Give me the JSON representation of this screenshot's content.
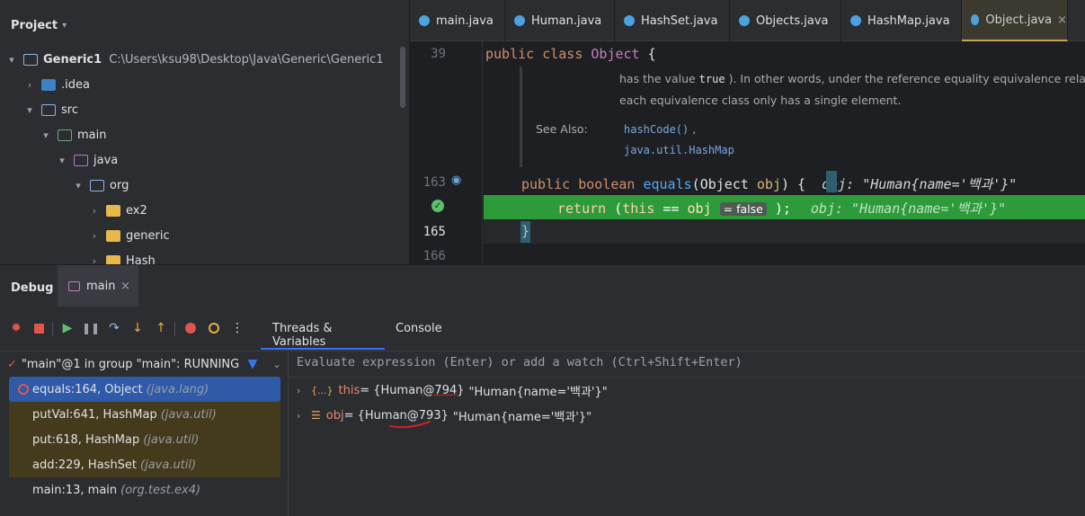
{
  "project": {
    "title": "Project",
    "root": {
      "name": "Generic1",
      "path": "C:\\Users\\ksu98\\Desktop\\Java\\Generic\\Generic1"
    },
    "items": [
      ".idea",
      "src",
      "main",
      "java",
      "org",
      "ex2",
      "generic",
      "Hash"
    ]
  },
  "editor": {
    "tabs": [
      {
        "label": "main.java"
      },
      {
        "label": "Human.java"
      },
      {
        "label": "HashSet.java"
      },
      {
        "label": "Objects.java"
      },
      {
        "label": "HashMap.java"
      },
      {
        "label": "Object.java",
        "close": "×"
      }
    ],
    "line_numbers": {
      "l39": "39",
      "l163": "163",
      "l165": "165",
      "l166": "166"
    },
    "code": {
      "line39": {
        "kw1": "public",
        "kw2": "class",
        "cls": "Object",
        "rest": " {"
      },
      "doc1_a": "has the value ",
      "doc1_code": "true",
      "doc1_b": "). In other words, under the reference equality equivalence relation,",
      "doc2": "each equivalence class only has a single element.",
      "see_also": "See Also:",
      "see_link1": "hashCode()",
      "see_link1_suffix": ",",
      "see_link2": "java.util.HashMap",
      "line163": {
        "kw1": "public",
        "kw2": "boolean",
        "fn": "equals",
        "open": "(",
        "type": "Object",
        "param": "obj",
        "close": ") {",
        "hint": "obj: \"Human{name='백과'}\""
      },
      "line164": {
        "kw": "return",
        "open": " (",
        "this": "this",
        "op": " == ",
        "obj": "obj",
        "value_hint": "= false",
        "close": ");",
        "hint": "obj: \"Human{name='백과'}\""
      },
      "line165": "}"
    }
  },
  "debug": {
    "title": "Debug",
    "session_tab": "main",
    "session_close": "×",
    "tabs": [
      "Threads & Variables",
      "Console"
    ],
    "thread": "\"main\"@1 in group \"main\": RUNNING",
    "eval_placeholder": "Evaluate expression (Enter) or add a watch (Ctrl+Shift+Enter)",
    "frames": [
      {
        "method": "equals:164, Object",
        "pkg": "(java.lang)"
      },
      {
        "method": "putVal:641, HashMap",
        "pkg": "(java.util)"
      },
      {
        "method": "put:618, HashMap",
        "pkg": "(java.util)"
      },
      {
        "method": "add:229, HashSet",
        "pkg": "(java.util)"
      },
      {
        "method": "main:13, main",
        "pkg": "(org.test.ex4)"
      }
    ],
    "variables": [
      {
        "name": "this",
        "eq": " = {Human",
        "ref": "@794",
        "close": "}",
        "value": "\"Human{name='백과'}\""
      },
      {
        "name": "obj",
        "eq": " = {Human",
        "ref": "@793",
        "close": "}",
        "value": "\"Human{name='백과'}\""
      }
    ]
  },
  "colors": {
    "accent": "#3574f0",
    "run_line": "#2e9b3b",
    "annotation": "#e0201c"
  }
}
